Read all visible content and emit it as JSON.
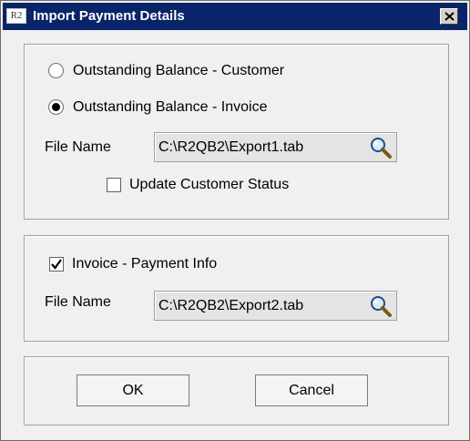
{
  "window": {
    "title": "Import Payment Details",
    "icon_text": "R2"
  },
  "section1": {
    "radio_customer": "Outstanding Balance - Customer",
    "radio_invoice": "Outstanding Balance - Invoice",
    "selected": "invoice",
    "file_label": "File Name",
    "file_value": "C:\\R2QB2\\Export1.tab",
    "update_status_label": "Update Customer Status",
    "update_status_checked": false
  },
  "section2": {
    "invoice_payment_label": "Invoice - Payment Info",
    "invoice_payment_checked": true,
    "file_label": "File Name",
    "file_value": "C:\\R2QB2\\Export2.tab"
  },
  "buttons": {
    "ok": "OK",
    "cancel": "Cancel"
  },
  "icons": {
    "browse": "magnifier-icon",
    "close": "close-icon",
    "app": "app-icon"
  }
}
